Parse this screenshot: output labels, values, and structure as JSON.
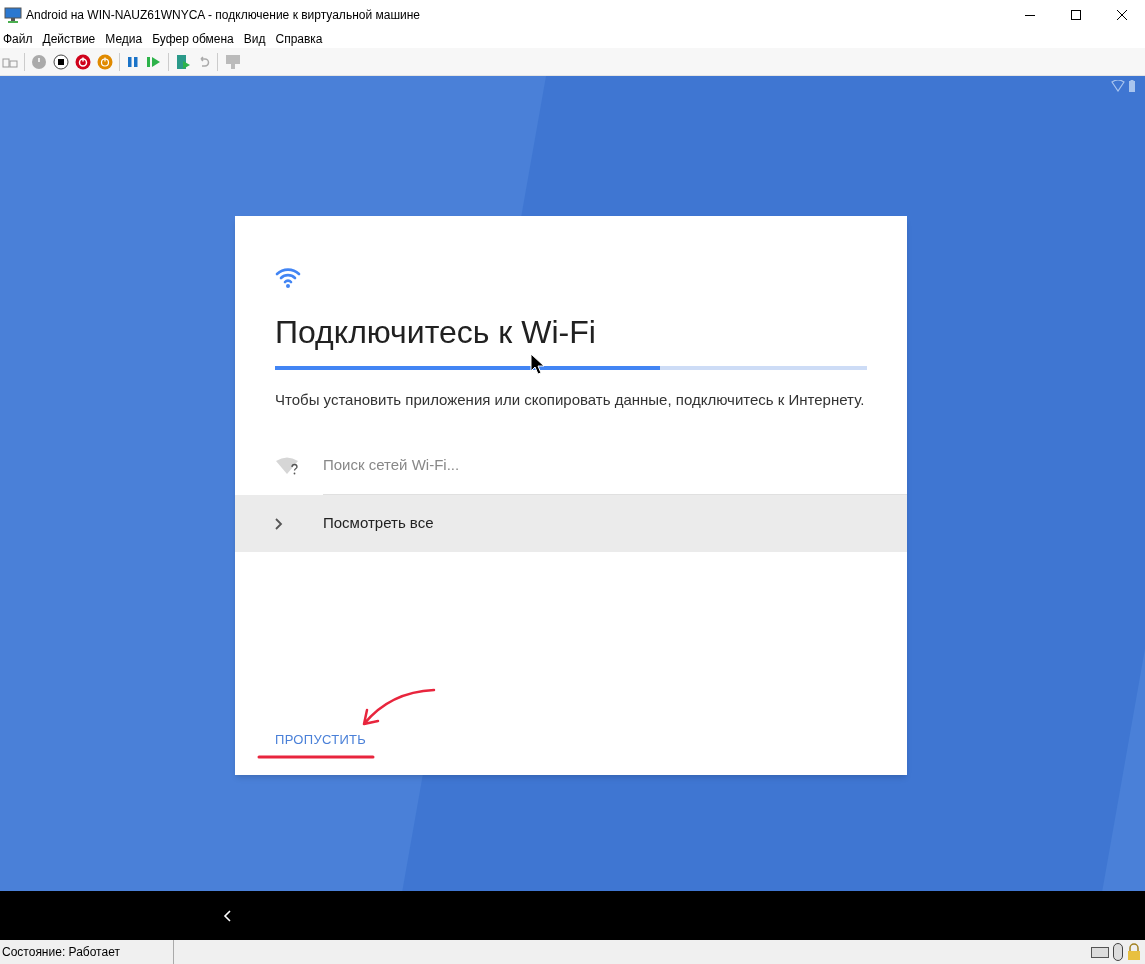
{
  "window": {
    "title": "Android на WIN-NAUZ61WNYCA - подключение к виртуальной машине"
  },
  "menu": [
    "Файл",
    "Действие",
    "Медиа",
    "Буфер обмена",
    "Вид",
    "Справка"
  ],
  "setup_card": {
    "title": "Подключитесь к Wi-Fi",
    "progress": {
      "level": 0.65
    },
    "description": "Чтобы установить приложения или скопировать данные, подключитесь к Интернету.",
    "items": [
      {
        "kind": "status",
        "label": "Поиск сетей Wi-Fi...",
        "selected": false
      },
      {
        "kind": "action",
        "label": "Посмотреть все",
        "selected": true
      }
    ],
    "skip_button": "ПРОПУСТИТЬ"
  },
  "status_bar": {
    "text": "Состояние: Работает"
  }
}
